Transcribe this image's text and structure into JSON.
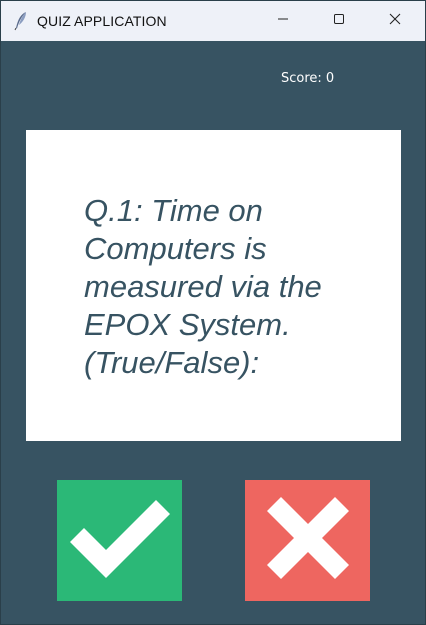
{
  "window": {
    "title": "QUIZ APPLICATION",
    "icons": {
      "app": "feather-icon",
      "minimize": "minimize-icon",
      "maximize": "maximize-icon",
      "close": "close-icon"
    }
  },
  "score": {
    "text": "Score: 0"
  },
  "question": {
    "text": "Q.1: Time on Computers is measured via the EPOX System. (True/False):"
  },
  "buttons": {
    "true_icon": "checkmark-icon",
    "false_icon": "cross-icon"
  },
  "colors": {
    "background": "#375362",
    "card": "#ffffff",
    "question_text": "#375362",
    "true_button": "#2bb877",
    "false_button": "#ee6660",
    "titlebar": "#eef1f8"
  }
}
